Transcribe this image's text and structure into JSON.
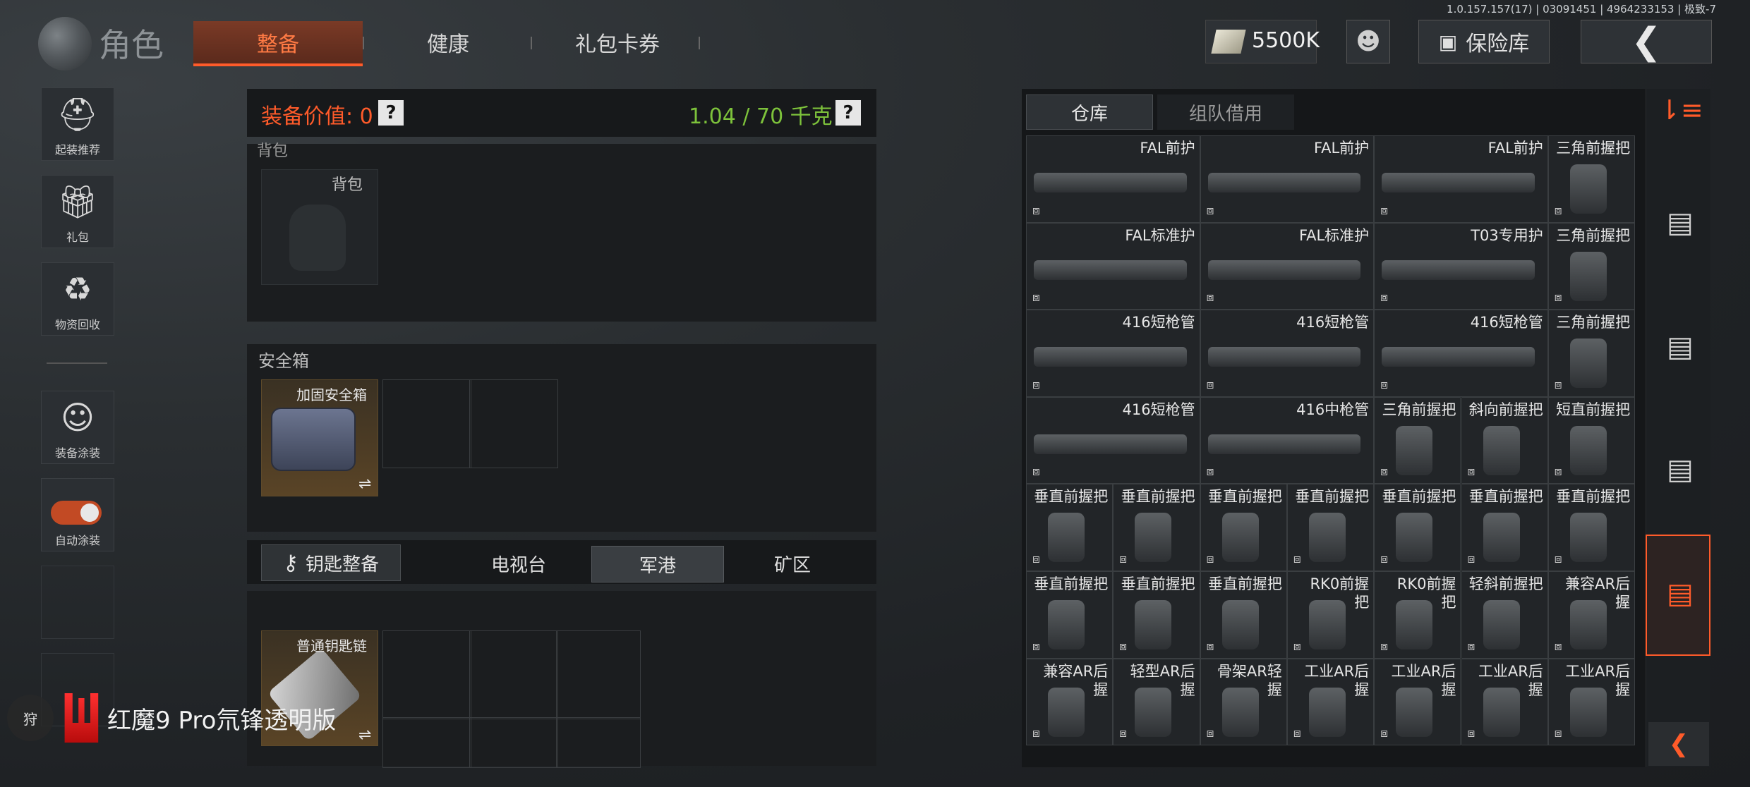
{
  "version": "1.0.157.157(17) | 03091451 | 4964233153 | 极致-7",
  "header": {
    "title": "角色",
    "tabs": [
      {
        "label": "整备",
        "active": true
      },
      {
        "label": "健康",
        "active": false
      },
      {
        "label": "礼包卡券",
        "active": false
      }
    ],
    "money": "5500K",
    "vault_label": "保险库"
  },
  "sidebar": {
    "items": [
      {
        "label": "起装推荐",
        "icon": "helmet-icon"
      },
      {
        "label": "礼包",
        "icon": "gift-icon"
      },
      {
        "label": "物资回收",
        "icon": "recycle-icon"
      },
      {
        "label": "装备涂装",
        "icon": "soldier-icon"
      },
      {
        "label": "自动涂装",
        "icon": "toggle-icon"
      }
    ],
    "auto_paint_on": true
  },
  "equipment": {
    "value_label": "装备价值: 0",
    "weight_label": "1.04 / 70 千克",
    "backpack_section_label": "背包",
    "backpack_slot_label": "背包",
    "safe_box_title": "安全箱",
    "safe_box_item": "加固安全箱",
    "key_button_label": "钥匙整备",
    "map_tabs": [
      {
        "label": "电视台",
        "active": false
      },
      {
        "label": "军港",
        "active": true
      },
      {
        "label": "矿区",
        "active": false
      }
    ],
    "keychain_item": "普通钥匙链"
  },
  "brand": {
    "circle_text": "狩",
    "text": "红魔9 Pro氘锋透明版"
  },
  "warehouse": {
    "tabs": [
      {
        "label": "仓库",
        "active": true
      },
      {
        "label": "组队借用",
        "active": false
      }
    ],
    "rows": [
      [
        {
          "name": "FAL前护",
          "w": 2
        },
        {
          "name": "FAL前护",
          "w": 2
        },
        {
          "name": "FAL前护",
          "w": 2
        },
        {
          "name": "三角前握把",
          "w": 1
        }
      ],
      [
        {
          "name": "FAL标准护",
          "w": 2
        },
        {
          "name": "FAL标准护",
          "w": 2
        },
        {
          "name": "T03专用护",
          "w": 2
        },
        {
          "name": "三角前握把",
          "w": 1
        }
      ],
      [
        {
          "name": "416短枪管",
          "w": 2
        },
        {
          "name": "416短枪管",
          "w": 2
        },
        {
          "name": "416短枪管",
          "w": 2
        },
        {
          "name": "三角前握把",
          "w": 1
        }
      ],
      [
        {
          "name": "416短枪管",
          "w": 2
        },
        {
          "name": "416中枪管",
          "w": 2
        },
        {
          "name": "三角前握把",
          "w": 1
        },
        {
          "name": "斜向前握把",
          "w": 1
        },
        {
          "name": "短直前握把",
          "w": 1
        }
      ],
      [
        {
          "name": "垂直前握把",
          "w": 1
        },
        {
          "name": "垂直前握把",
          "w": 1
        },
        {
          "name": "垂直前握把",
          "w": 1
        },
        {
          "name": "垂直前握把",
          "w": 1
        },
        {
          "name": "垂直前握把",
          "w": 1
        },
        {
          "name": "垂直前握把",
          "w": 1
        },
        {
          "name": "垂直前握把",
          "w": 1
        }
      ],
      [
        {
          "name": "垂直前握把",
          "w": 1
        },
        {
          "name": "垂直前握把",
          "w": 1
        },
        {
          "name": "垂直前握把",
          "w": 1
        },
        {
          "name": "RK0前握\n把",
          "w": 1
        },
        {
          "name": "RK0前握\n把",
          "w": 1
        },
        {
          "name": "轻斜前握把",
          "w": 1
        },
        {
          "name": "兼容AR后\n握",
          "w": 1
        }
      ],
      [
        {
          "name": "兼容AR后\n握",
          "w": 1
        },
        {
          "name": "轻型AR后\n握",
          "w": 1
        },
        {
          "name": "骨架AR轻\n握",
          "w": 1
        },
        {
          "name": "工业AR后\n握",
          "w": 1
        },
        {
          "name": "工业AR后\n握",
          "w": 1
        },
        {
          "name": "工业AR后\n握",
          "w": 1
        },
        {
          "name": "工业AR后\n握",
          "w": 1
        }
      ]
    ]
  },
  "colors": {
    "accent": "#ff5b2a",
    "weight": "#7dc23b"
  }
}
